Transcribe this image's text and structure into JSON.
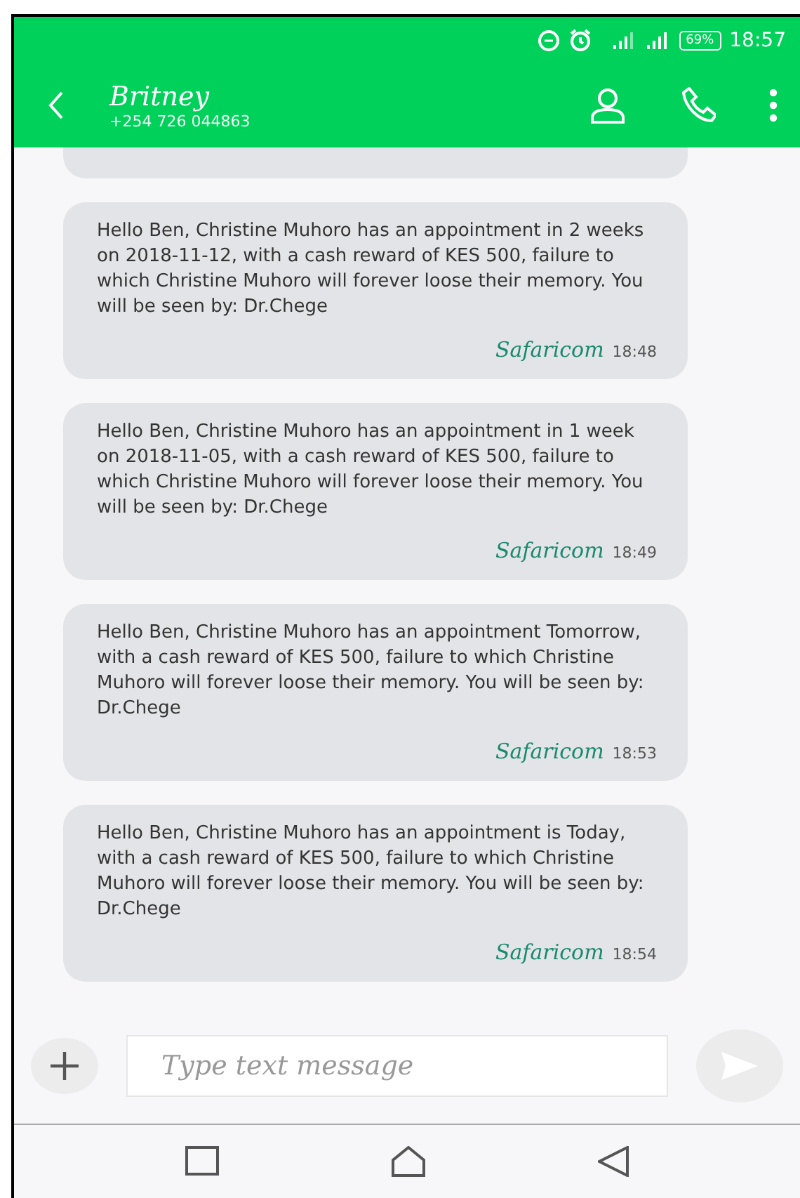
{
  "status_bar": {
    "battery": "69%",
    "time": "18:57"
  },
  "contact": {
    "name": "Britney",
    "number": "+254 726 044863"
  },
  "messages": [
    {
      "text": "Hello Ben, Christine  Muhoro has an appointment in 2 weeks on 2018-11-12, with a cash reward of KES 500, failure to which Christine  Muhoro will forever loose their memory. You will be seen by: Dr.Chege",
      "sender": "Safaricom",
      "time": "18:48"
    },
    {
      "text": "Hello Ben, Christine  Muhoro has an appointment in 1 week on 2018-11-05, with a cash reward of KES 500, failure to which Christine  Muhoro will forever loose their memory. You will be seen by: Dr.Chege",
      "sender": "Safaricom",
      "time": "18:49"
    },
    {
      "text": "Hello Ben, Christine  Muhoro has an appointment Tomorrow, with a cash reward of KES 500, failure to which Christine  Muhoro will forever loose their memory. You will be seen by: Dr.Chege",
      "sender": "Safaricom",
      "time": "18:53"
    },
    {
      "text": "Hello Ben, Christine  Muhoro has an appointment is Today, with a cash reward of KES 500, failure to which Christine  Muhoro will forever loose their memory. You will be seen by: Dr.Chege",
      "sender": "Safaricom",
      "time": "18:54"
    }
  ],
  "composer": {
    "placeholder": "Type text message"
  }
}
